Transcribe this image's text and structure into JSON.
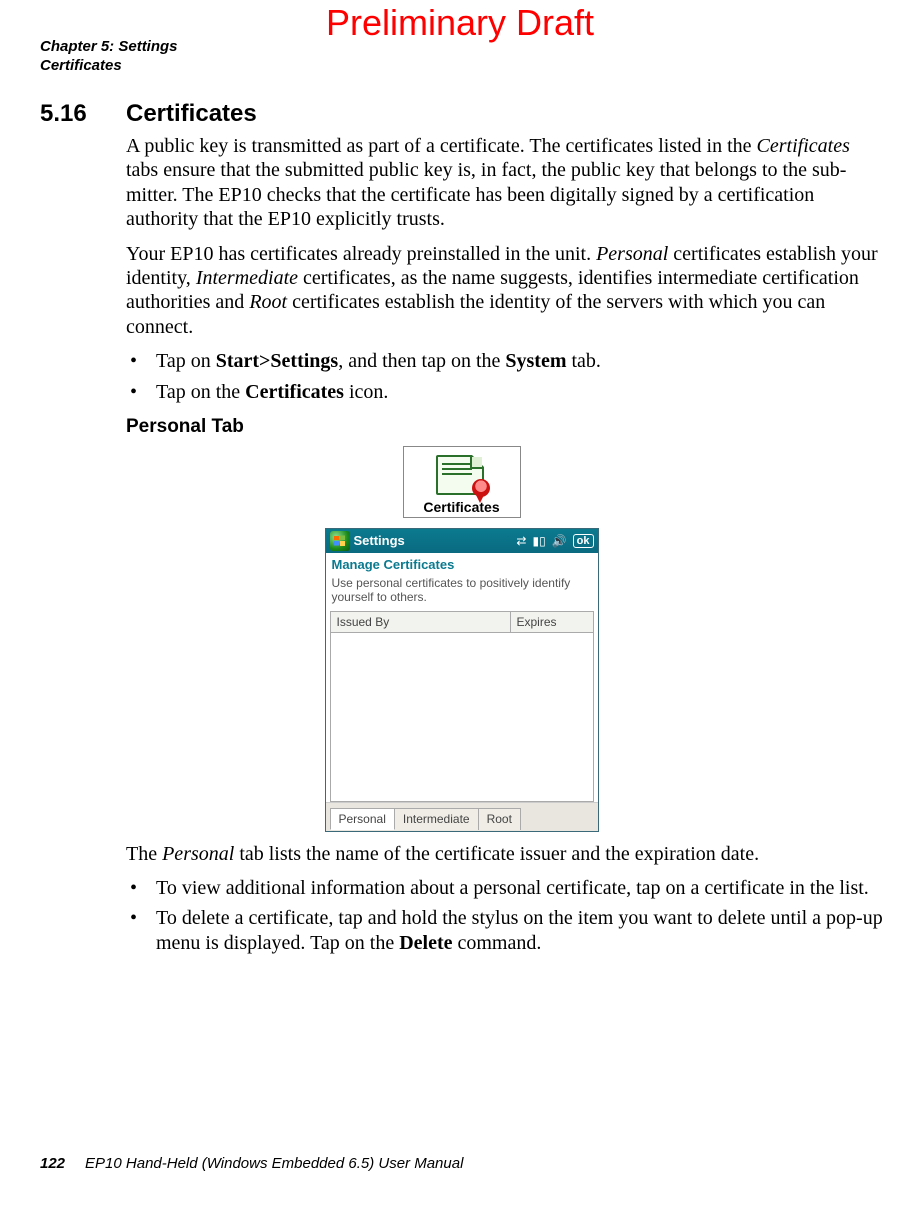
{
  "watermark": "Preliminary Draft",
  "header": {
    "line1": "Chapter 5: Settings",
    "line2": "Certificates"
  },
  "section": {
    "number": "5.16",
    "title": "Certificates"
  },
  "para1_parts": {
    "a": "A public key is transmitted as part of a certificate. The certificates listed in the ",
    "em1": "Certificates",
    "b": " tabs ensure that the submitted public key is, in fact, the public key that belongs to the sub­mitter. The EP10 checks that the certificate has been digitally signed by a certification authority that the EP10 explicitly trusts."
  },
  "para2_parts": {
    "a": "Your EP10 has certificates already preinstalled in the unit. ",
    "em1": "Personal",
    "b": " certificates establish your identity, ",
    "em2": "Intermediate",
    "c": " certificates, as the name suggests, identifies intermediate certifi­cation authorities and ",
    "em3": "Root",
    "d": " certificates establish the identity of the servers with which you can connect."
  },
  "bullets1": {
    "b1": {
      "pre": "Tap on ",
      "s1": "Start>Settings",
      "mid": ", and then tap on the ",
      "s2": "System",
      "post": " tab."
    },
    "b2": {
      "pre": "Tap on the ",
      "s1": "Certificates",
      "post": " icon."
    }
  },
  "subheading": "Personal Tab",
  "icon_label": "Certificates",
  "wm": {
    "title": "Settings",
    "ok": "ok",
    "subtitle": "Manage Certificates",
    "desc": "Use personal certificates to positively identify yourself to others.",
    "col1": "Issued By",
    "col2": "Expires",
    "tabs": {
      "t1": "Personal",
      "t2": "Intermediate",
      "t3": "Root"
    }
  },
  "para3_parts": {
    "a": "The ",
    "em1": "Personal",
    "b": " tab lists the name of the certificate issuer and the expiration date."
  },
  "bullets2": {
    "b1": "To view additional information about a personal certificate, tap on a certificate in the list.",
    "b2": {
      "pre": "To delete a certificate, tap and hold the stylus on the item you want to delete until a pop-up menu is displayed. Tap on the ",
      "s1": "Delete",
      "post": " command."
    }
  },
  "footer": {
    "page": "122",
    "text": "EP10 Hand-Held (Windows Embedded 6.5) User Manual"
  }
}
